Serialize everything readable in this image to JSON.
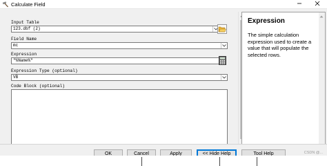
{
  "window": {
    "title": "Calculate Field",
    "minimize_icon": "minimize-icon",
    "close_icon": "close-icon"
  },
  "form": {
    "input_table": {
      "label": "Input Table",
      "value": "123.dbf (2)"
    },
    "field_name": {
      "label": "Field Name",
      "value": "mc"
    },
    "expression": {
      "label": "Expression",
      "value": "\"%Name%\""
    },
    "expression_type": {
      "label": "Expression Type (optional)",
      "value": "VB"
    },
    "code_block": {
      "label": "Code Block (optional)",
      "value": ""
    }
  },
  "help": {
    "title": "Expression",
    "body": "The simple calculation expression used to create a value that will populate the selected rows."
  },
  "buttons": {
    "ok": "OK",
    "cancel": "Cancel",
    "apply": "Apply",
    "hide_help": "<< Hide Help",
    "tool_help": "Tool Help"
  },
  "watermark": "CSDN @...",
  "colors": {
    "accent": "#0078d7",
    "folder": "#e8b23a"
  }
}
